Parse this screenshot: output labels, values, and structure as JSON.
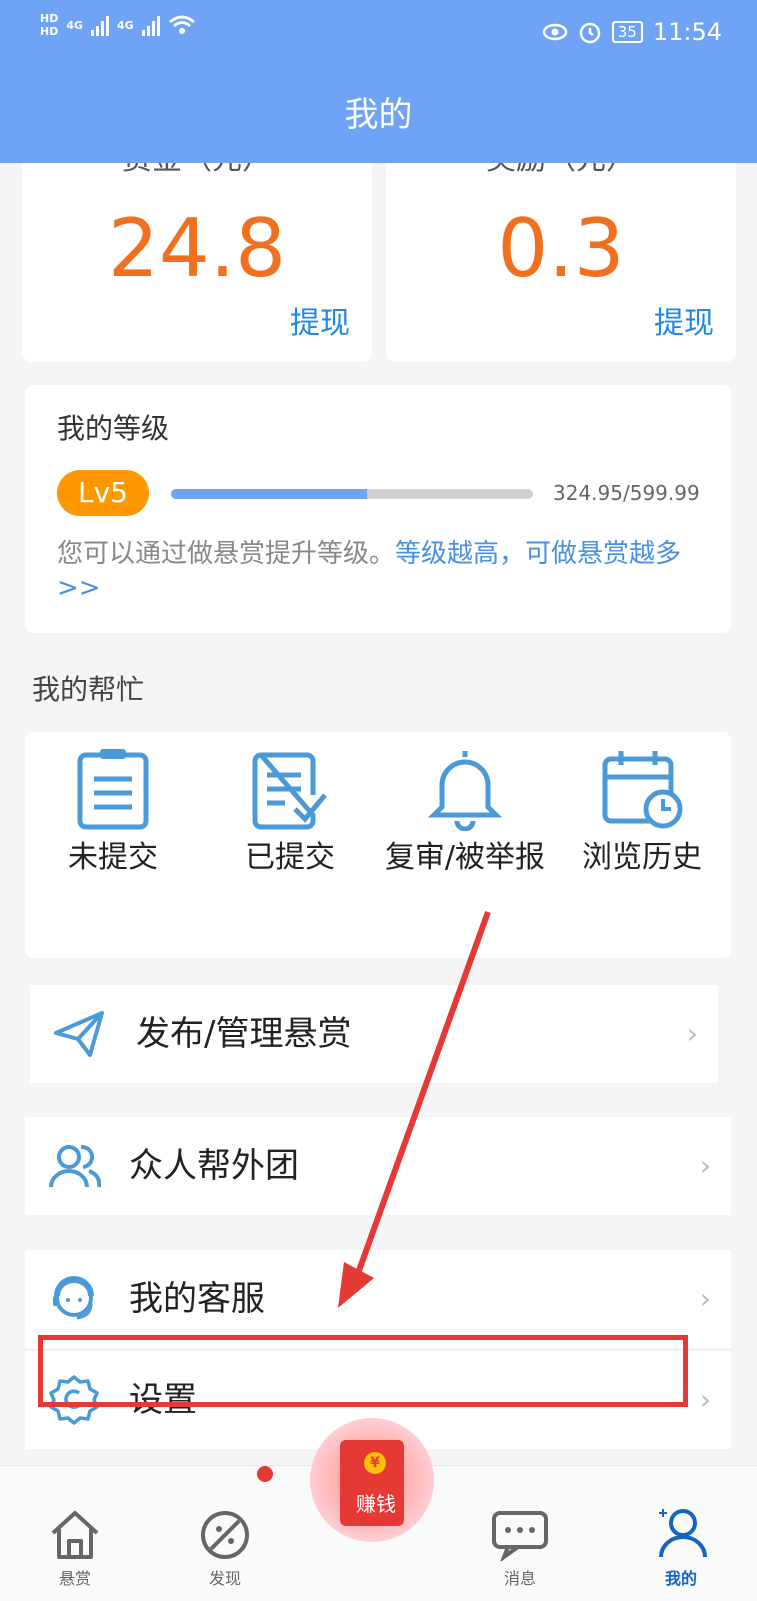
{
  "status_bar": {
    "hd1": "HD",
    "hd2": "HD",
    "net1": "4G",
    "net2": "4G",
    "battery": "35",
    "time": "11:54"
  },
  "header": {
    "title": "我的"
  },
  "balance": {
    "bounty_label": "赏金（元）",
    "bounty_value": "24.8",
    "bounty_action": "提现",
    "reward_label": "奖励（元）",
    "reward_value": "0.3",
    "reward_action": "提现"
  },
  "level": {
    "title": "我的等级",
    "badge": "Lv5",
    "progress_fraction": 0.5416,
    "progress_text": "324.95/599.99",
    "desc_plain": "您可以通过做悬赏提升等级。",
    "desc_link": "等级越高，可做悬赏越多>>"
  },
  "help": {
    "title": "我的帮忙",
    "items": [
      {
        "label": "未提交",
        "icon": "clipboard-icon"
      },
      {
        "label": "已提交",
        "icon": "checked-document-icon"
      },
      {
        "label": "复审/被举报",
        "icon": "bell-icon"
      },
      {
        "label": "浏览历史",
        "icon": "calendar-clock-icon"
      }
    ]
  },
  "menu": [
    {
      "label": "发布/管理悬赏",
      "icon": "paper-plane-icon"
    },
    {
      "label": "众人帮外团",
      "icon": "users-icon"
    },
    {
      "label": "我的客服",
      "icon": "customer-service-icon"
    },
    {
      "label": "设置",
      "icon": "gear-icon"
    }
  ],
  "tabbar": {
    "items": [
      {
        "label": "悬赏",
        "icon": "home-icon"
      },
      {
        "label": "发现",
        "icon": "discover-icon"
      },
      {
        "label": "赚钱",
        "icon": "red-packet-icon"
      },
      {
        "label": "消息",
        "icon": "message-icon"
      },
      {
        "label": "我的",
        "icon": "profile-icon"
      }
    ],
    "earn_coin": "¥"
  },
  "colors": {
    "primary": "#6fa3f5",
    "amount": "#f07020",
    "link": "#1e88e5",
    "level_badge": "#ff9800",
    "annotation": "#e53935"
  }
}
